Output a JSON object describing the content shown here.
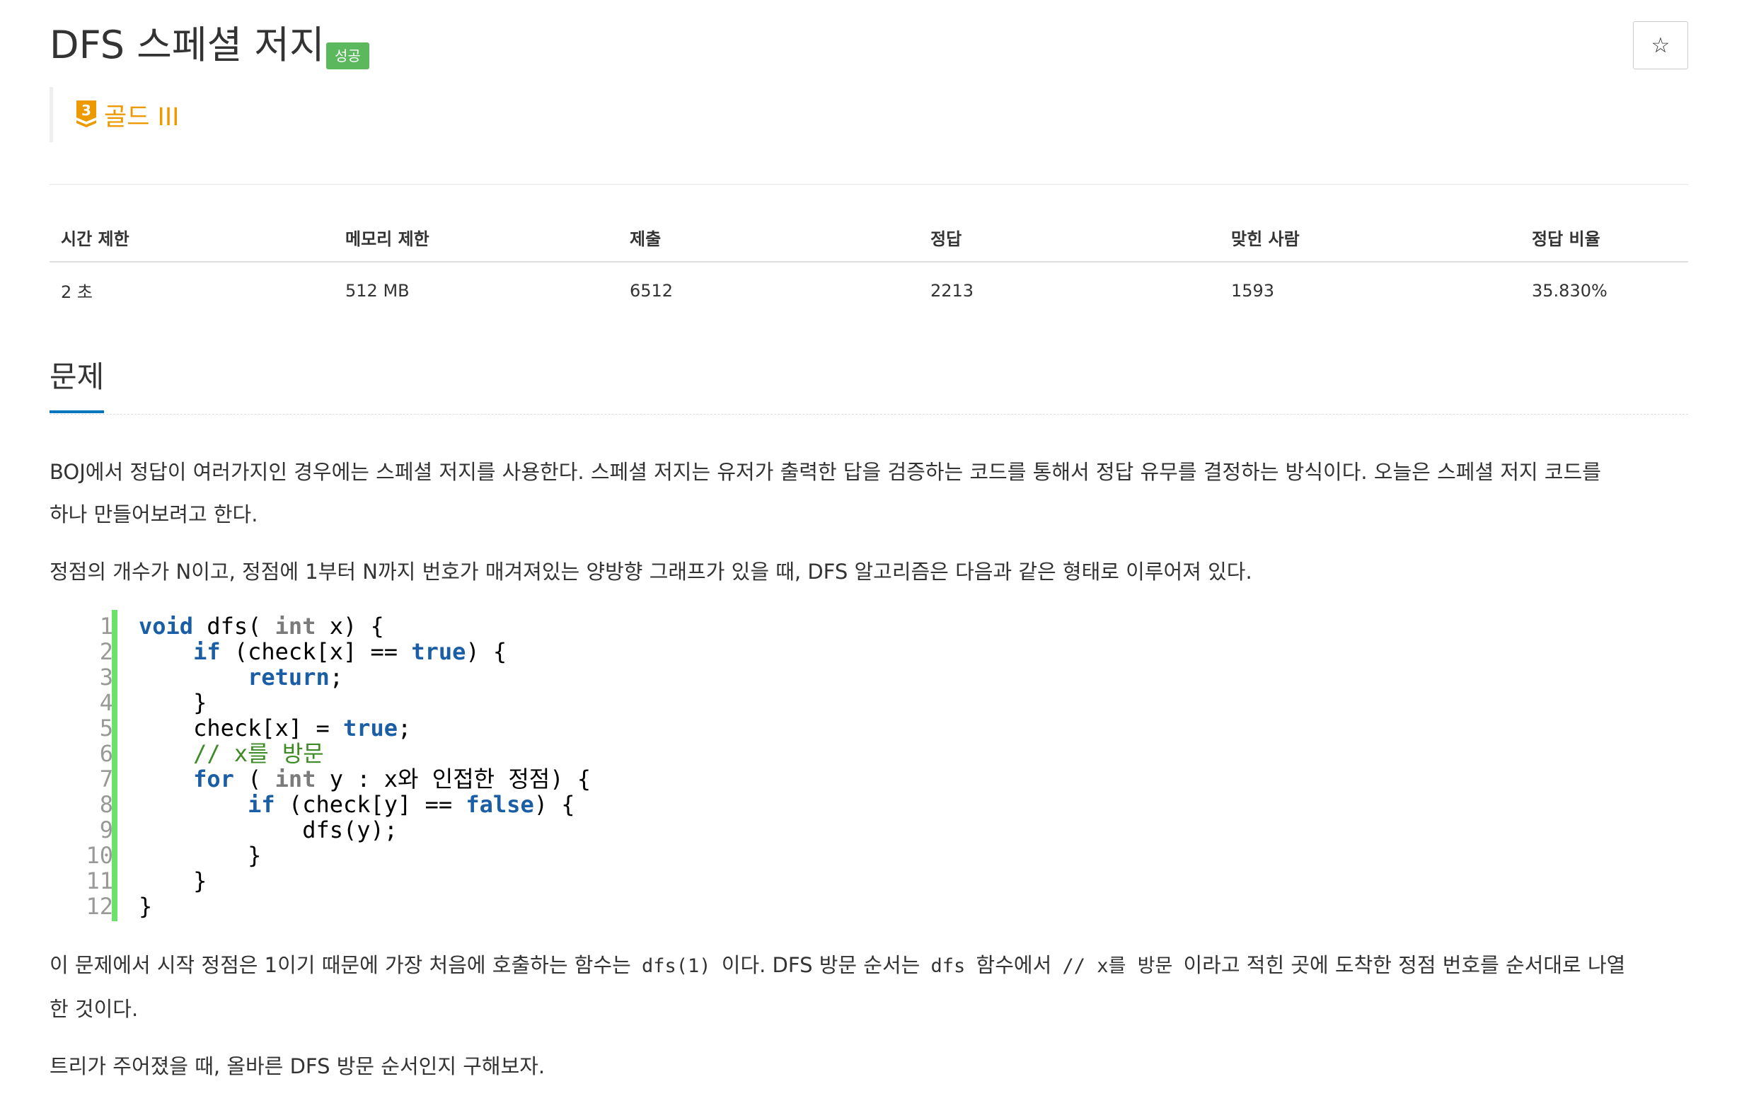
{
  "problem": {
    "title": "DFS 스페셜 저지",
    "status_badge": "성공",
    "star_icon_glyph": "☆",
    "tier": {
      "number": "3",
      "label": "골드 III",
      "color": "#ec9a00"
    }
  },
  "info_table": {
    "headers": [
      "시간 제한",
      "메모리 제한",
      "제출",
      "정답",
      "맞힌 사람",
      "정답 비율"
    ],
    "values": [
      "2 초",
      "512 MB",
      "6512",
      "2213",
      "1593",
      "35.830%"
    ]
  },
  "section": {
    "title": "문제"
  },
  "description": {
    "p1_line1": "BOJ에서 정답이 여러가지인 경우에는 스페셜 저지를 사용한다. 스페셜 저지는 유저가 출력한 답을 검증하는 코드를 통해서 정답 유무를 결정하는 방식이다. 오늘은 스페셜 저지 코드를",
    "p1_line2": "하나 만들어보려고 한다.",
    "p2": "정점의 개수가 N이고, 정점에 1부터 N까지 번호가 매겨져있는 양방향 그래프가 있을 때, DFS 알고리즘은 다음과 같은 형태로 이루어져 있다.",
    "p3_a": "이 문제에서 시작 정점은 1이기 때문에 가장 처음에 호출하는 함수는",
    "p3_code1": "dfs(1)",
    "p3_b": "이다. DFS 방문 순서는",
    "p3_code2": "dfs",
    "p3_c": "함수에서",
    "p3_code3": "// x를 방문",
    "p3_d": "이라고 적힌 곳에 도착한 정점 번호를 순서대로 나열",
    "p3_line2": "한 것이다.",
    "p4": "트리가 주어졌을 때, 올바른 DFS 방문 순서인지 구해보자."
  },
  "code_lines": [
    [
      [
        "kw",
        "void"
      ],
      [
        "",
        "dfs("
      ],
      [
        "ty",
        "int"
      ],
      [
        "",
        "x) {"
      ]
    ],
    [
      [
        "",
        "    "
      ],
      [
        "kw",
        "if"
      ],
      [
        "",
        "(check[x] == "
      ],
      [
        "kw",
        "true"
      ],
      [
        "",
        ") {"
      ]
    ],
    [
      [
        "",
        "        "
      ],
      [
        "kw",
        "return"
      ],
      [
        "",
        ";"
      ]
    ],
    [
      [
        "",
        "    }"
      ]
    ],
    [
      [
        "",
        "    check[x] = "
      ],
      [
        "kw",
        "true"
      ],
      [
        "",
        ";"
      ]
    ],
    [
      [
        "",
        "    "
      ],
      [
        "cm",
        "// x를 방문"
      ]
    ],
    [
      [
        "",
        "    "
      ],
      [
        "kw",
        "for"
      ],
      [
        "",
        "("
      ],
      [
        "ty",
        "int"
      ],
      [
        "",
        "y : x와 인접한 정점) {"
      ]
    ],
    [
      [
        "",
        "        "
      ],
      [
        "kw",
        "if"
      ],
      [
        "",
        "(check[y] == "
      ],
      [
        "kw",
        "false"
      ],
      [
        "",
        ") {"
      ]
    ],
    [
      [
        "",
        "            dfs(y);"
      ]
    ],
    [
      [
        "",
        "        }"
      ]
    ],
    [
      [
        "",
        "    }"
      ]
    ],
    [
      [
        "",
        "}"
      ]
    ]
  ]
}
